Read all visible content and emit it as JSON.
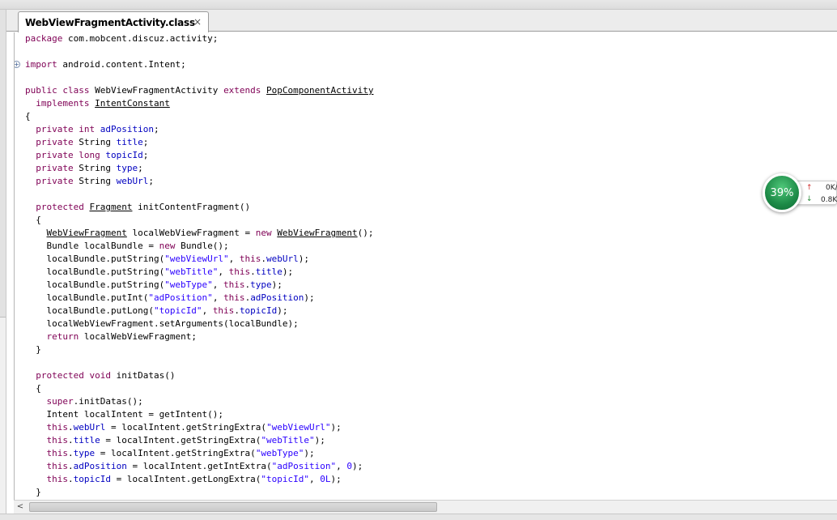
{
  "tab": {
    "title": "WebViewFragmentActivity.class",
    "close_glyph": "×"
  },
  "net_monitor": {
    "percent": "39%",
    "upload": "0K/",
    "download": "0.8K/",
    "up_icon": "arrow-up-icon",
    "down_icon": "arrow-down-icon"
  },
  "code_lines": [
    [
      {
        "t": "package",
        "c": "kw"
      },
      {
        "t": " com.mobcent.discuz.activity;"
      }
    ],
    [],
    [
      {
        "t": "import",
        "c": "kw"
      },
      {
        "t": " android.content.Intent;"
      }
    ],
    [],
    [
      {
        "t": "public class",
        "c": "kw"
      },
      {
        "t": " WebViewFragmentActivity "
      },
      {
        "t": "extends",
        "c": "kw"
      },
      {
        "t": " "
      },
      {
        "t": "PopComponentActivity",
        "c": "ul"
      }
    ],
    [
      {
        "t": "  "
      },
      {
        "t": "implements",
        "c": "kw"
      },
      {
        "t": " "
      },
      {
        "t": "IntentConstant",
        "c": "ul"
      }
    ],
    [
      {
        "t": "{"
      }
    ],
    [
      {
        "t": "  "
      },
      {
        "t": "private int",
        "c": "kw"
      },
      {
        "t": " "
      },
      {
        "t": "adPosition",
        "c": "fld"
      },
      {
        "t": ";"
      }
    ],
    [
      {
        "t": "  "
      },
      {
        "t": "private",
        "c": "kw"
      },
      {
        "t": " String "
      },
      {
        "t": "title",
        "c": "fld"
      },
      {
        "t": ";"
      }
    ],
    [
      {
        "t": "  "
      },
      {
        "t": "private long",
        "c": "kw"
      },
      {
        "t": " "
      },
      {
        "t": "topicId",
        "c": "fld"
      },
      {
        "t": ";"
      }
    ],
    [
      {
        "t": "  "
      },
      {
        "t": "private",
        "c": "kw"
      },
      {
        "t": " String "
      },
      {
        "t": "type",
        "c": "fld"
      },
      {
        "t": ";"
      }
    ],
    [
      {
        "t": "  "
      },
      {
        "t": "private",
        "c": "kw"
      },
      {
        "t": " String "
      },
      {
        "t": "webUrl",
        "c": "fld"
      },
      {
        "t": ";"
      }
    ],
    [],
    [
      {
        "t": "  "
      },
      {
        "t": "protected",
        "c": "kw"
      },
      {
        "t": " "
      },
      {
        "t": "Fragment",
        "c": "ul"
      },
      {
        "t": " initContentFragment()"
      }
    ],
    [
      {
        "t": "  {"
      }
    ],
    [
      {
        "t": "    "
      },
      {
        "t": "WebViewFragment",
        "c": "ul"
      },
      {
        "t": " localWebViewFragment = "
      },
      {
        "t": "new",
        "c": "kw"
      },
      {
        "t": " "
      },
      {
        "t": "WebViewFragment",
        "c": "ul"
      },
      {
        "t": "();"
      }
    ],
    [
      {
        "t": "    Bundle localBundle = "
      },
      {
        "t": "new",
        "c": "kw"
      },
      {
        "t": " Bundle();"
      }
    ],
    [
      {
        "t": "    localBundle.putString("
      },
      {
        "t": "\"webViewUrl\"",
        "c": "str"
      },
      {
        "t": ", "
      },
      {
        "t": "this",
        "c": "kw"
      },
      {
        "t": "."
      },
      {
        "t": "webUrl",
        "c": "fld"
      },
      {
        "t": ");"
      }
    ],
    [
      {
        "t": "    localBundle.putString("
      },
      {
        "t": "\"webTitle\"",
        "c": "str"
      },
      {
        "t": ", "
      },
      {
        "t": "this",
        "c": "kw"
      },
      {
        "t": "."
      },
      {
        "t": "title",
        "c": "fld"
      },
      {
        "t": ");"
      }
    ],
    [
      {
        "t": "    localBundle.putString("
      },
      {
        "t": "\"webType\"",
        "c": "str"
      },
      {
        "t": ", "
      },
      {
        "t": "this",
        "c": "kw"
      },
      {
        "t": "."
      },
      {
        "t": "type",
        "c": "fld"
      },
      {
        "t": ");"
      }
    ],
    [
      {
        "t": "    localBundle.putInt("
      },
      {
        "t": "\"adPosition\"",
        "c": "str"
      },
      {
        "t": ", "
      },
      {
        "t": "this",
        "c": "kw"
      },
      {
        "t": "."
      },
      {
        "t": "adPosition",
        "c": "fld"
      },
      {
        "t": ");"
      }
    ],
    [
      {
        "t": "    localBundle.putLong("
      },
      {
        "t": "\"topicId\"",
        "c": "str"
      },
      {
        "t": ", "
      },
      {
        "t": "this",
        "c": "kw"
      },
      {
        "t": "."
      },
      {
        "t": "topicId",
        "c": "fld"
      },
      {
        "t": ");"
      }
    ],
    [
      {
        "t": "    localWebViewFragment.setArguments(localBundle);"
      }
    ],
    [
      {
        "t": "    "
      },
      {
        "t": "return",
        "c": "kw"
      },
      {
        "t": " localWebViewFragment;"
      }
    ],
    [
      {
        "t": "  }"
      }
    ],
    [],
    [
      {
        "t": "  "
      },
      {
        "t": "protected void",
        "c": "kw"
      },
      {
        "t": " initDatas()"
      }
    ],
    [
      {
        "t": "  {"
      }
    ],
    [
      {
        "t": "    "
      },
      {
        "t": "super",
        "c": "kw"
      },
      {
        "t": ".initDatas();"
      }
    ],
    [
      {
        "t": "    Intent localIntent = getIntent();"
      }
    ],
    [
      {
        "t": "    "
      },
      {
        "t": "this",
        "c": "kw"
      },
      {
        "t": "."
      },
      {
        "t": "webUrl",
        "c": "fld"
      },
      {
        "t": " = localIntent.getStringExtra("
      },
      {
        "t": "\"webViewUrl\"",
        "c": "str"
      },
      {
        "t": ");"
      }
    ],
    [
      {
        "t": "    "
      },
      {
        "t": "this",
        "c": "kw"
      },
      {
        "t": "."
      },
      {
        "t": "title",
        "c": "fld"
      },
      {
        "t": " = localIntent.getStringExtra("
      },
      {
        "t": "\"webTitle\"",
        "c": "str"
      },
      {
        "t": ");"
      }
    ],
    [
      {
        "t": "    "
      },
      {
        "t": "this",
        "c": "kw"
      },
      {
        "t": "."
      },
      {
        "t": "type",
        "c": "fld"
      },
      {
        "t": " = localIntent.getStringExtra("
      },
      {
        "t": "\"webType\"",
        "c": "str"
      },
      {
        "t": ");"
      }
    ],
    [
      {
        "t": "    "
      },
      {
        "t": "this",
        "c": "kw"
      },
      {
        "t": "."
      },
      {
        "t": "adPosition",
        "c": "fld"
      },
      {
        "t": " = localIntent.getIntExtra("
      },
      {
        "t": "\"adPosition\"",
        "c": "str"
      },
      {
        "t": ", "
      },
      {
        "t": "0",
        "c": "num"
      },
      {
        "t": ");"
      }
    ],
    [
      {
        "t": "    "
      },
      {
        "t": "this",
        "c": "kw"
      },
      {
        "t": "."
      },
      {
        "t": "topicId",
        "c": "fld"
      },
      {
        "t": " = localIntent.getLongExtra("
      },
      {
        "t": "\"topicId\"",
        "c": "str"
      },
      {
        "t": ", "
      },
      {
        "t": "0L",
        "c": "num"
      },
      {
        "t": ");"
      }
    ],
    [
      {
        "t": "  }"
      }
    ]
  ],
  "fold_marker": "+",
  "scroll_left_glyph": "<"
}
